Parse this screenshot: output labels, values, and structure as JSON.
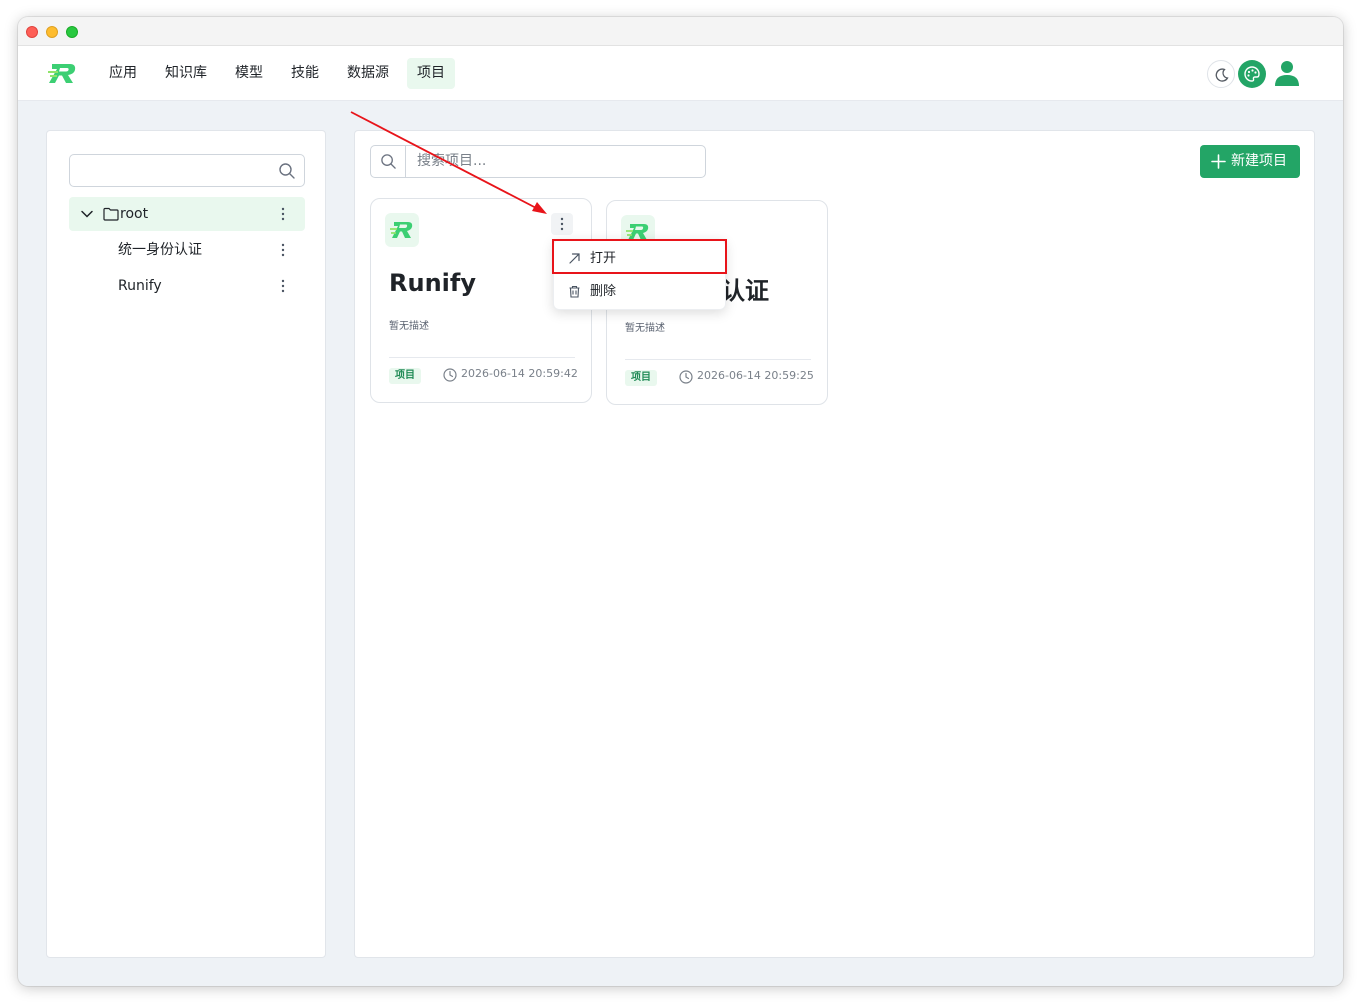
{
  "navbar": {
    "items": [
      {
        "label": "应用"
      },
      {
        "label": "知识库"
      },
      {
        "label": "模型"
      },
      {
        "label": "技能"
      },
      {
        "label": "数据源"
      },
      {
        "label": "项目",
        "active": true
      }
    ]
  },
  "sidebar": {
    "search_placeholder": "",
    "tree": [
      {
        "label": "root",
        "expanded": true,
        "selected": true
      },
      {
        "label": "统一身份认证"
      },
      {
        "label": "Runify"
      }
    ]
  },
  "main": {
    "search_placeholder": "搜索项目...",
    "new_button_label": "新建项目",
    "cards": [
      {
        "title": "Runify",
        "description": "暂无描述",
        "tag": "项目",
        "date": "2026-06-14 20:59:42"
      },
      {
        "title": "统一身份认证",
        "visible_title": "认证",
        "description": "暂无描述",
        "tag": "项目",
        "date": "2026-06-14 20:59:25"
      }
    ],
    "context_menu": {
      "items": [
        {
          "label": "打开",
          "icon": "arrow-up-right-icon",
          "highlighted": true
        },
        {
          "label": "删除",
          "icon": "trash-icon"
        }
      ]
    }
  },
  "colors": {
    "accent": "#23a566",
    "accent_light": "#e9f8ee",
    "annotation": "#e8141a"
  }
}
